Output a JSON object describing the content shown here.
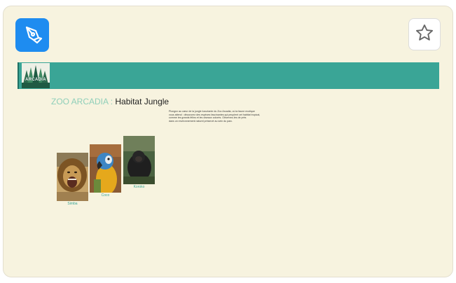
{
  "app": {
    "icon": "pen-nib-icon",
    "accent": "#1e8cf0"
  },
  "favorite": {
    "icon": "star-outline-icon"
  },
  "banner": {
    "color": "#3aa596",
    "logo_text": "ARCADIA"
  },
  "page": {
    "title_brand": "ZOO ARCADIA",
    "title_separator": ":",
    "title_habitat": "Habitat Jungle",
    "description": [
      "Plongez au cœur de la jungle luxuriante du Zoo Arcadia, où la faune exotique",
      "vous attend : découvrez des espèces fascinantes qui peuplent cet habitat tropical,",
      "comme les grands félins et les oiseaux colorés. Observez-les de près",
      "dans un environnement naturel préservé au sein du parc."
    ],
    "link_word": "Coco"
  },
  "animals": [
    {
      "name": "Simba",
      "icon": "lion-photo"
    },
    {
      "name": "Coco",
      "icon": "parrot-photo"
    },
    {
      "name": "Koroko",
      "icon": "gorilla-photo"
    }
  ]
}
